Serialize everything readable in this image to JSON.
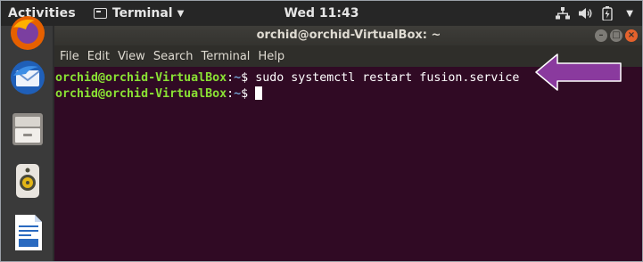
{
  "topbar": {
    "activities": "Activities",
    "app_name": "Terminal",
    "clock": "Wed 11:43"
  },
  "window": {
    "title": "orchid@orchid-VirtualBox: ~"
  },
  "menu": [
    "File",
    "Edit",
    "View",
    "Search",
    "Terminal",
    "Help"
  ],
  "terminal": {
    "lines": [
      {
        "user_host": "orchid@orchid-VirtualBox",
        "sep": ":",
        "path": "~",
        "symbol": "$ ",
        "command": "sudo systemctl restart fusion.service"
      },
      {
        "user_host": "orchid@orchid-VirtualBox",
        "sep": ":",
        "path": "~",
        "symbol": "$ ",
        "command": ""
      }
    ]
  },
  "dock": [
    "firefox-icon",
    "thunderbird-icon",
    "files-icon",
    "rhythmbox-icon",
    "writer-icon"
  ],
  "colors": {
    "terminal_bg": "#300a24",
    "prompt_green": "#8ae234",
    "path_blue": "#729fcf",
    "annotation_arrow": "#8a3a9e"
  }
}
